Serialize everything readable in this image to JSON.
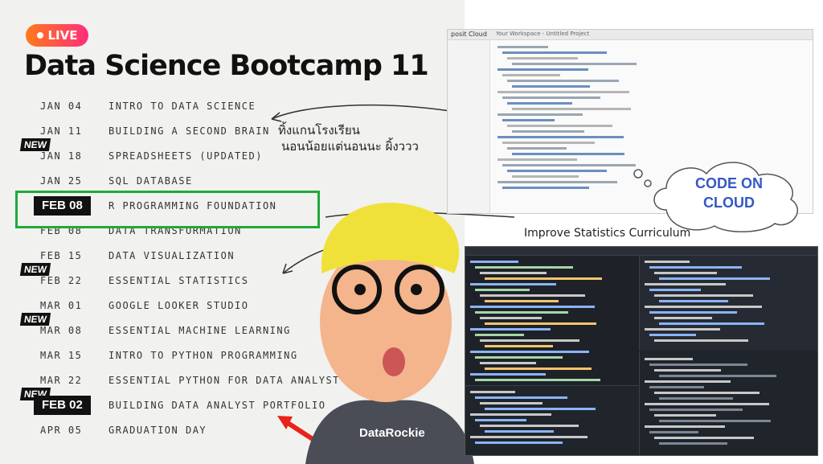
{
  "badge": {
    "live_label": "LIVE"
  },
  "title": "Data Science Bootcamp 11",
  "schedule": [
    {
      "date": "JAN 04",
      "topic": "INTRO TO DATA SCIENCE",
      "new": false,
      "highlight": false
    },
    {
      "date": "JAN 11",
      "topic": "BUILDING A SECOND BRAIN",
      "new": false,
      "highlight": false
    },
    {
      "date": "JAN 18",
      "topic": "SPREADSHEETS (UPDATED)",
      "new": true,
      "highlight": false
    },
    {
      "date": "JAN 25",
      "topic": "SQL DATABASE",
      "new": false,
      "highlight": false
    },
    {
      "date": "FEB 08",
      "topic": "R PROGRAMMING FOUNDATION",
      "new": false,
      "highlight": true
    },
    {
      "date": "FEB 08",
      "topic": "DATA TRANSFORMATION",
      "new": false,
      "highlight": false
    },
    {
      "date": "FEB 15",
      "topic": "DATA VISUALIZATION",
      "new": false,
      "highlight": false
    },
    {
      "date": "FEB 22",
      "topic": "ESSENTIAL STATISTICS",
      "new": true,
      "highlight": false
    },
    {
      "date": "MAR 01",
      "topic": "GOOGLE LOOKER STUDIO",
      "new": false,
      "highlight": false
    },
    {
      "date": "MAR 08",
      "topic": "ESSENTIAL MACHINE LEARNING",
      "new": true,
      "highlight": false
    },
    {
      "date": "MAR 15",
      "topic": "INTRO TO PYTHON PROGRAMMING",
      "new": false,
      "highlight": false
    },
    {
      "date": "MAR 22",
      "topic": "ESSENTIAL PYTHON FOR DATA ANALYST",
      "new": false,
      "highlight": false
    },
    {
      "date": "FEB 02",
      "topic": "BUILDING DATA ANALYST PORTFOLIO",
      "new": true,
      "highlight": true
    },
    {
      "date": "APR 05",
      "topic": "GRADUATION DAY",
      "new": false,
      "highlight": false
    }
  ],
  "new_label": "NEW",
  "annotations": {
    "thai_line1": "ทิ้งแกนโรงเรียน",
    "thai_line2": "นอนน้อยแต่นอนนะ ผิ้งววว",
    "improve": "Improve Statistics Curriculum",
    "cloud": "CODE ON CLOUD",
    "brand": "DataRockie"
  },
  "screens": {
    "top_app": "posit Cloud",
    "top_title": "Your Workspace - Untitled Project"
  },
  "colors": {
    "accent_green": "#1faa3a",
    "cloud_text": "#3458c4",
    "arrow_red": "#e8231a"
  }
}
